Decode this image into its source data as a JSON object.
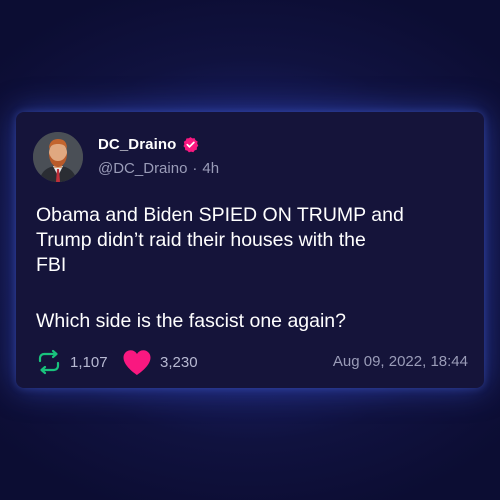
{
  "tweet": {
    "display_name": "DC_Draino",
    "handle": "@DC_Draino",
    "separator": "·",
    "age": "4h",
    "lines": [
      "Obama and Biden SPIED ON TRUMP and",
      "Trump didn’t raid their houses with the",
      "FBI"
    ],
    "second_paragraph": "Which side is the fascist one again?",
    "retweets": "1,107",
    "likes": "3,230",
    "timestamp": "Aug 09, 2022, 18:44"
  },
  "icons": {
    "verified": "verified-badge-icon",
    "retweet": "retweet-icon",
    "like": "heart-icon"
  },
  "colors": {
    "card_bg": "#15143a",
    "verified": "#f91880",
    "retweet": "#19c37d",
    "heart": "#f91880",
    "muted_text": "#9a9cb8"
  }
}
